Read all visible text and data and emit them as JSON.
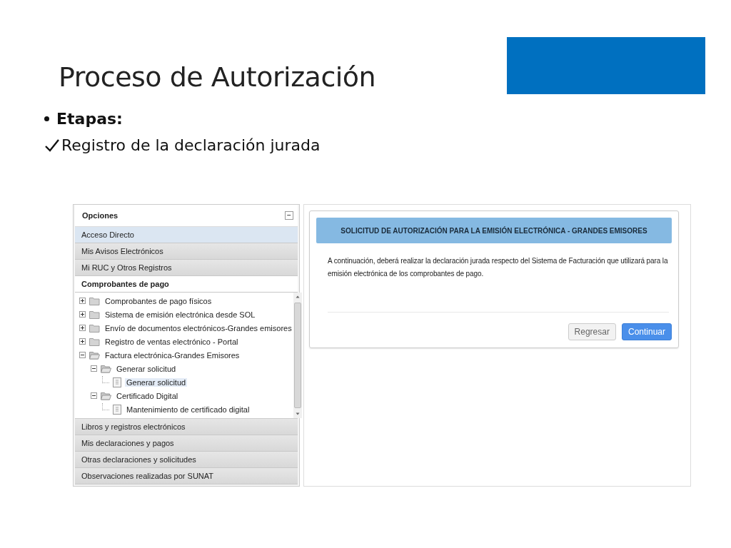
{
  "slide": {
    "title": "Proceso de Autorización",
    "bullet": "Etapas:",
    "check_item": "Registro de la declaración jurada"
  },
  "sidebar": {
    "header": "Opciones",
    "collapse_symbol": "−",
    "sections_before": [
      {
        "label": "Acceso Directo",
        "selected": true,
        "expanded": false
      },
      {
        "label": "Mis Avisos Electrónicos",
        "selected": false,
        "expanded": false
      },
      {
        "label": "Mi RUC y Otros Registros",
        "selected": false,
        "expanded": false
      },
      {
        "label": "Comprobantes de pago",
        "selected": false,
        "expanded": true
      }
    ],
    "tree": [
      {
        "kind": "folder",
        "label": "Comprobantes de pago físicos",
        "expanded": false
      },
      {
        "kind": "folder",
        "label": "Sistema de emisión electrónica desde SOL",
        "expanded": false
      },
      {
        "kind": "folder",
        "label": "Envío de documentos electrónicos-Grandes emisores",
        "expanded": false
      },
      {
        "kind": "folder",
        "label": "Registro de ventas electrónico - Portal",
        "expanded": false
      },
      {
        "kind": "folder",
        "label": "Factura electrónica-Grandes Emisores",
        "expanded": true,
        "children": [
          {
            "kind": "folder",
            "label": "Generar solicitud",
            "expanded": true,
            "children": [
              {
                "kind": "leaf",
                "label": "Generar solicitud",
                "selected": true
              }
            ]
          },
          {
            "kind": "folder",
            "label": "Certificado Digital",
            "expanded": true,
            "children": [
              {
                "kind": "leaf",
                "label": "Mantenimiento de certificado digital",
                "selected": false
              }
            ]
          }
        ]
      }
    ],
    "sections_after": [
      {
        "label": "Libros y registros electrónicos",
        "selected": false,
        "expanded": false
      },
      {
        "label": "Mis declaraciones y pagos",
        "selected": false,
        "expanded": false
      },
      {
        "label": "Otras declaraciones y solicitudes",
        "selected": false,
        "expanded": false
      },
      {
        "label": "Observaciones realizadas por SUNAT",
        "selected": false,
        "expanded": false
      }
    ]
  },
  "panel": {
    "heading": "SOLICITUD DE AUTORIZACIÓN PARA LA EMISIÓN ELECTRÓNICA - GRANDES EMISORES",
    "message": "A continuación, deberá realizar la declaración jurada respecto del Sistema de Facturación que utilizará para la emisión electrónica de los comprobantes de pago.",
    "buttons": [
      {
        "label": "Regresar",
        "kind": "secondary"
      },
      {
        "label": "Continuar",
        "kind": "primary"
      }
    ]
  }
}
